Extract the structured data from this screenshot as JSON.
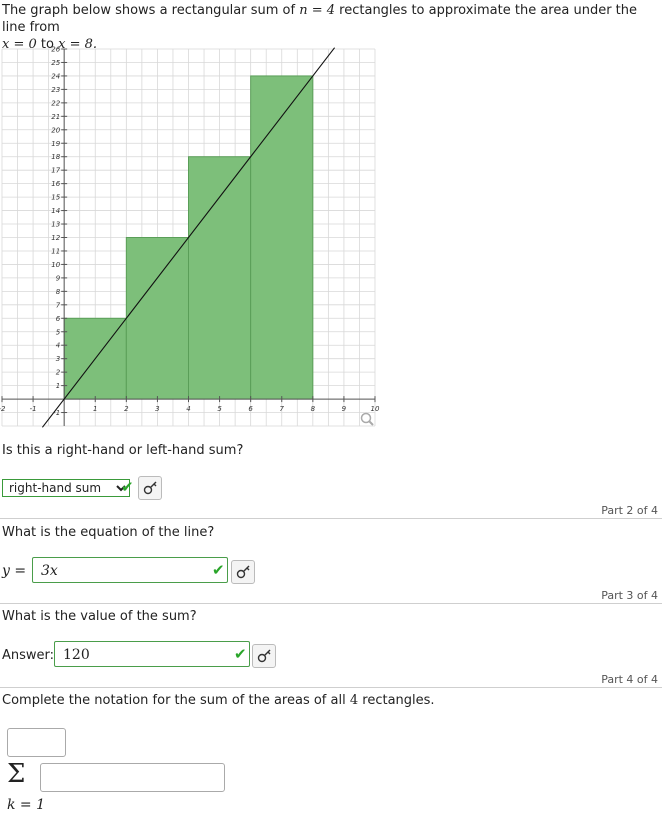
{
  "intro": {
    "part_a": "The graph below shows a rectangular sum of",
    "n_expr": "n = 4",
    "part_b": "rectangles to approximate the area under the line from",
    "x_start": "x = 0",
    "to": "to",
    "x_end": "x = 8."
  },
  "chart_data": {
    "type": "bar",
    "description_type": "riemann-sum",
    "xlim": [
      -2,
      10
    ],
    "ylim": [
      -2,
      26
    ],
    "x_ticks": [
      -2,
      -1,
      1,
      2,
      3,
      4,
      5,
      6,
      7,
      8,
      9,
      10
    ],
    "y_ticks": [
      -1,
      1,
      2,
      3,
      4,
      5,
      6,
      7,
      8,
      9,
      10,
      11,
      12,
      13,
      14,
      15,
      16,
      17,
      18,
      19,
      20,
      21,
      22,
      23,
      24,
      25,
      26
    ],
    "rectangles": [
      {
        "x0": 0,
        "x1": 2,
        "height": 6
      },
      {
        "x0": 2,
        "x1": 4,
        "height": 12
      },
      {
        "x0": 4,
        "x1": 6,
        "height": 18
      },
      {
        "x0": 6,
        "x1": 8,
        "height": 24
      }
    ],
    "line": {
      "slope": 3,
      "intercept": 0,
      "x_from": -0.7,
      "x_to": 8.7
    },
    "grid": true,
    "colors": {
      "fill": "#7dbf7a",
      "edge": "#5a9e58",
      "line": "#111111",
      "grid": "#d8d8d8"
    }
  },
  "part1": {
    "question": "Is this a right-hand or left-hand sum?",
    "select_value": "right-hand sum",
    "select_options": [
      "right-hand sum"
    ]
  },
  "part2": {
    "label": "Part 2 of 4",
    "question": "What is the equation of the line?",
    "lhs": "y =",
    "value": "3x"
  },
  "part3": {
    "label": "Part 3 of 4",
    "question": "What is the value of the sum?",
    "answer_label": "Answer:",
    "value": "120"
  },
  "part4": {
    "label": "Part 4 of 4",
    "question_a": "Complete the notation for the sum of the areas of all",
    "n": "4",
    "question_b": "rectangles.",
    "sigma": "Σ",
    "lower_index": "k = 1"
  },
  "icons": {
    "correct": "check-icon",
    "key": "key-icon",
    "zoom": "magnifier-icon"
  },
  "colors": {
    "correct": "#2aa52a",
    "field_border": "#4a9d4a"
  }
}
